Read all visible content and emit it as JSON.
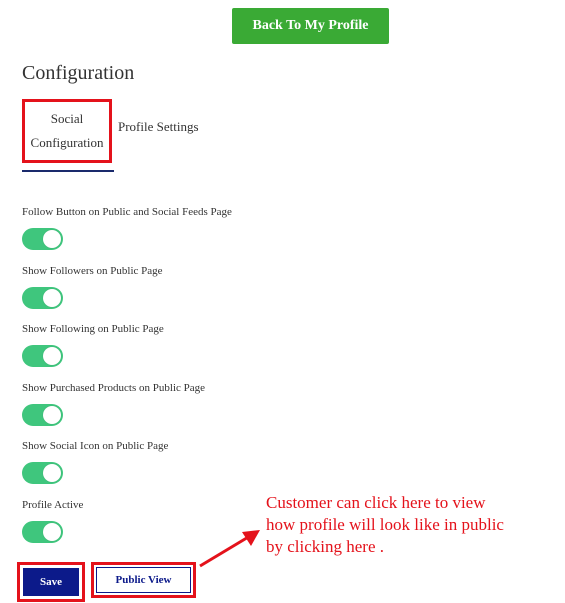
{
  "header": {
    "back_button": "Back To My Profile"
  },
  "page": {
    "title": "Configuration"
  },
  "tabs": {
    "social_line1": "Social",
    "social_line2": "Configuration",
    "profile_settings": "Profile Settings"
  },
  "settings": [
    {
      "label": "Follow Button on Public and Social Feeds Page",
      "enabled": true
    },
    {
      "label": "Show Followers on Public Page",
      "enabled": true
    },
    {
      "label": "Show Following on Public Page",
      "enabled": true
    },
    {
      "label": "Show Purchased Products on Public Page",
      "enabled": true
    },
    {
      "label": "Show Social Icon on Public Page",
      "enabled": true
    },
    {
      "label": "Profile Active",
      "enabled": true
    }
  ],
  "actions": {
    "save": "Save",
    "public_view": "Public View"
  },
  "annotation": {
    "line1": "Customer can click here to view",
    "line2": "how profile will look like in public",
    "line3": "by clicking here ."
  },
  "colors": {
    "primary_green": "#3aaa35",
    "toggle_on": "#3fc67d",
    "navy": "#0c1a8a",
    "highlight_red": "#e4121b"
  }
}
